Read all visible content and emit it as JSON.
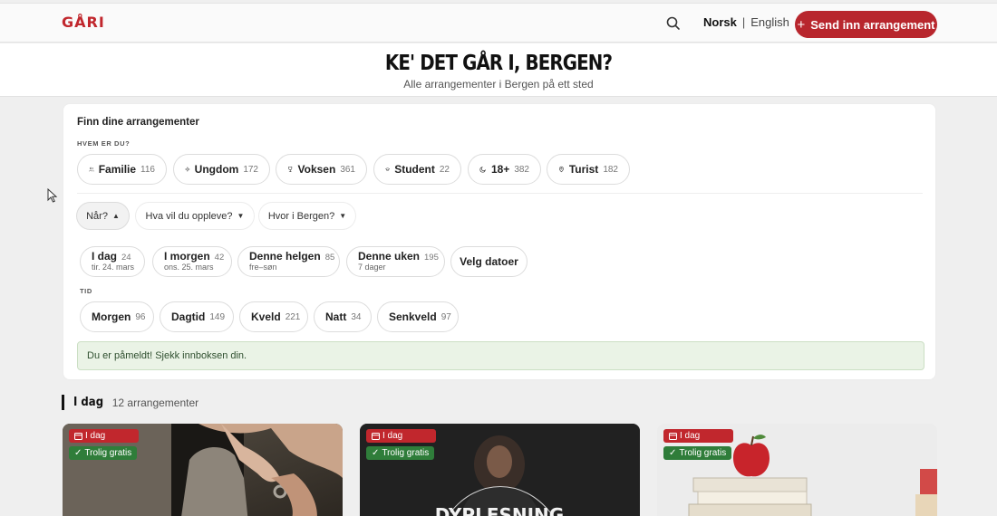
{
  "header": {
    "logo": "GÅRI",
    "lang_active": "Norsk",
    "lang_separator": "|",
    "lang_other": "English",
    "send_label": "Send inn arrangement",
    "send_plus": "+"
  },
  "hero": {
    "title": "KE' DET GÅR I, BERGEN?",
    "subtitle": "Alle arrangementer i Bergen på ett sted"
  },
  "filters": {
    "panel_title": "Finn dine arrangementer",
    "audience_label": "HVEM ER DU?",
    "audience": [
      {
        "label": "Familie",
        "count": "116",
        "icon": "family-icon"
      },
      {
        "label": "Ungdom",
        "count": "172",
        "icon": "sparkle-icon"
      },
      {
        "label": "Voksen",
        "count": "361",
        "icon": "wine-icon"
      },
      {
        "label": "Student",
        "count": "22",
        "icon": "graduation-cap-icon"
      },
      {
        "label": "18+",
        "count": "382",
        "icon": "moon-icon"
      },
      {
        "label": "Turist",
        "count": "182",
        "icon": "map-pin-icon"
      }
    ],
    "dropdowns": [
      {
        "label": "Når?",
        "arrow": "▲"
      },
      {
        "label": "Hva vil du oppleve?",
        "arrow": "▼"
      },
      {
        "label": "Hvor i Bergen?",
        "arrow": "▼"
      }
    ],
    "dates": [
      {
        "label": "I dag",
        "count": "24",
        "sub": "tir. 24. mars"
      },
      {
        "label": "I morgen",
        "count": "42",
        "sub": "ons. 25. mars"
      },
      {
        "label": "Denne helgen",
        "count": "85",
        "sub": "fre–søn"
      },
      {
        "label": "Denne uken",
        "count": "195",
        "sub": "7 dager"
      }
    ],
    "pick_dates": "Velg datoer",
    "time_label": "TID",
    "times": [
      {
        "label": "Morgen",
        "count": "96"
      },
      {
        "label": "Dagtid",
        "count": "149"
      },
      {
        "label": "Kveld",
        "count": "221"
      },
      {
        "label": "Natt",
        "count": "34"
      },
      {
        "label": "Senkveld",
        "count": "97"
      }
    ],
    "success_message": "Du er påmeldt! Sjekk innboksen din."
  },
  "section": {
    "title": "I dag",
    "count": "12 arrangementer"
  },
  "cards": [
    {
      "date_badge": "I dag",
      "free_badge": "Trolig gratis"
    },
    {
      "date_badge": "I dag",
      "free_badge": "Trolig gratis",
      "image_text": "DYPLESNING"
    },
    {
      "date_badge": "I dag",
      "free_badge": "Trolig gratis"
    }
  ],
  "colors": {
    "accent": "#c1272d",
    "success_bg": "#eaf3e6",
    "free_badge": "#2f7d3a"
  }
}
